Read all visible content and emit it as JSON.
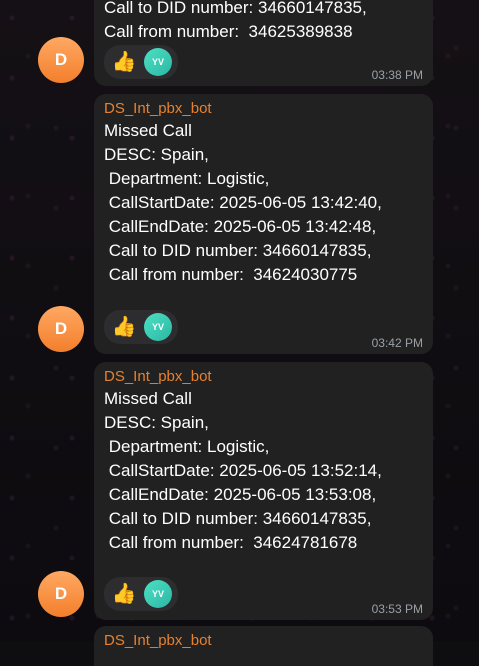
{
  "messages": [
    {
      "id": "msg1",
      "sender": "",
      "lines": [
        "Call to DID number: 34660147835,",
        "Call from number:  34625389838"
      ],
      "time": "03:38 PM",
      "reaction_emoji": "👍",
      "reaction_user": "YV",
      "avatar_letter": "D"
    },
    {
      "id": "msg2",
      "sender": "DS_Int_pbx_bot",
      "lines": [
        "Missed Call",
        "DESC: Spain,",
        " Department: Logistic,",
        " CallStartDate: 2025-06-05 13:42:40,",
        " CallEndDate: 2025-06-05 13:42:48,",
        " Call to DID number: 34660147835,",
        " Call from number:  34624030775"
      ],
      "time": "03:42 PM",
      "reaction_emoji": "👍",
      "reaction_user": "YV",
      "avatar_letter": "D"
    },
    {
      "id": "msg3",
      "sender": "DS_Int_pbx_bot",
      "lines": [
        "Missed Call",
        "DESC: Spain,",
        " Department: Logistic,",
        " CallStartDate: 2025-06-05 13:52:14,",
        " CallEndDate: 2025-06-05 13:53:08,",
        " Call to DID number: 34660147835,",
        " Call from number:  34624781678"
      ],
      "time": "03:53 PM",
      "reaction_emoji": "👍",
      "reaction_user": "YV",
      "avatar_letter": "D"
    }
  ],
  "next_sender": "DS_Int_pbx_bot"
}
